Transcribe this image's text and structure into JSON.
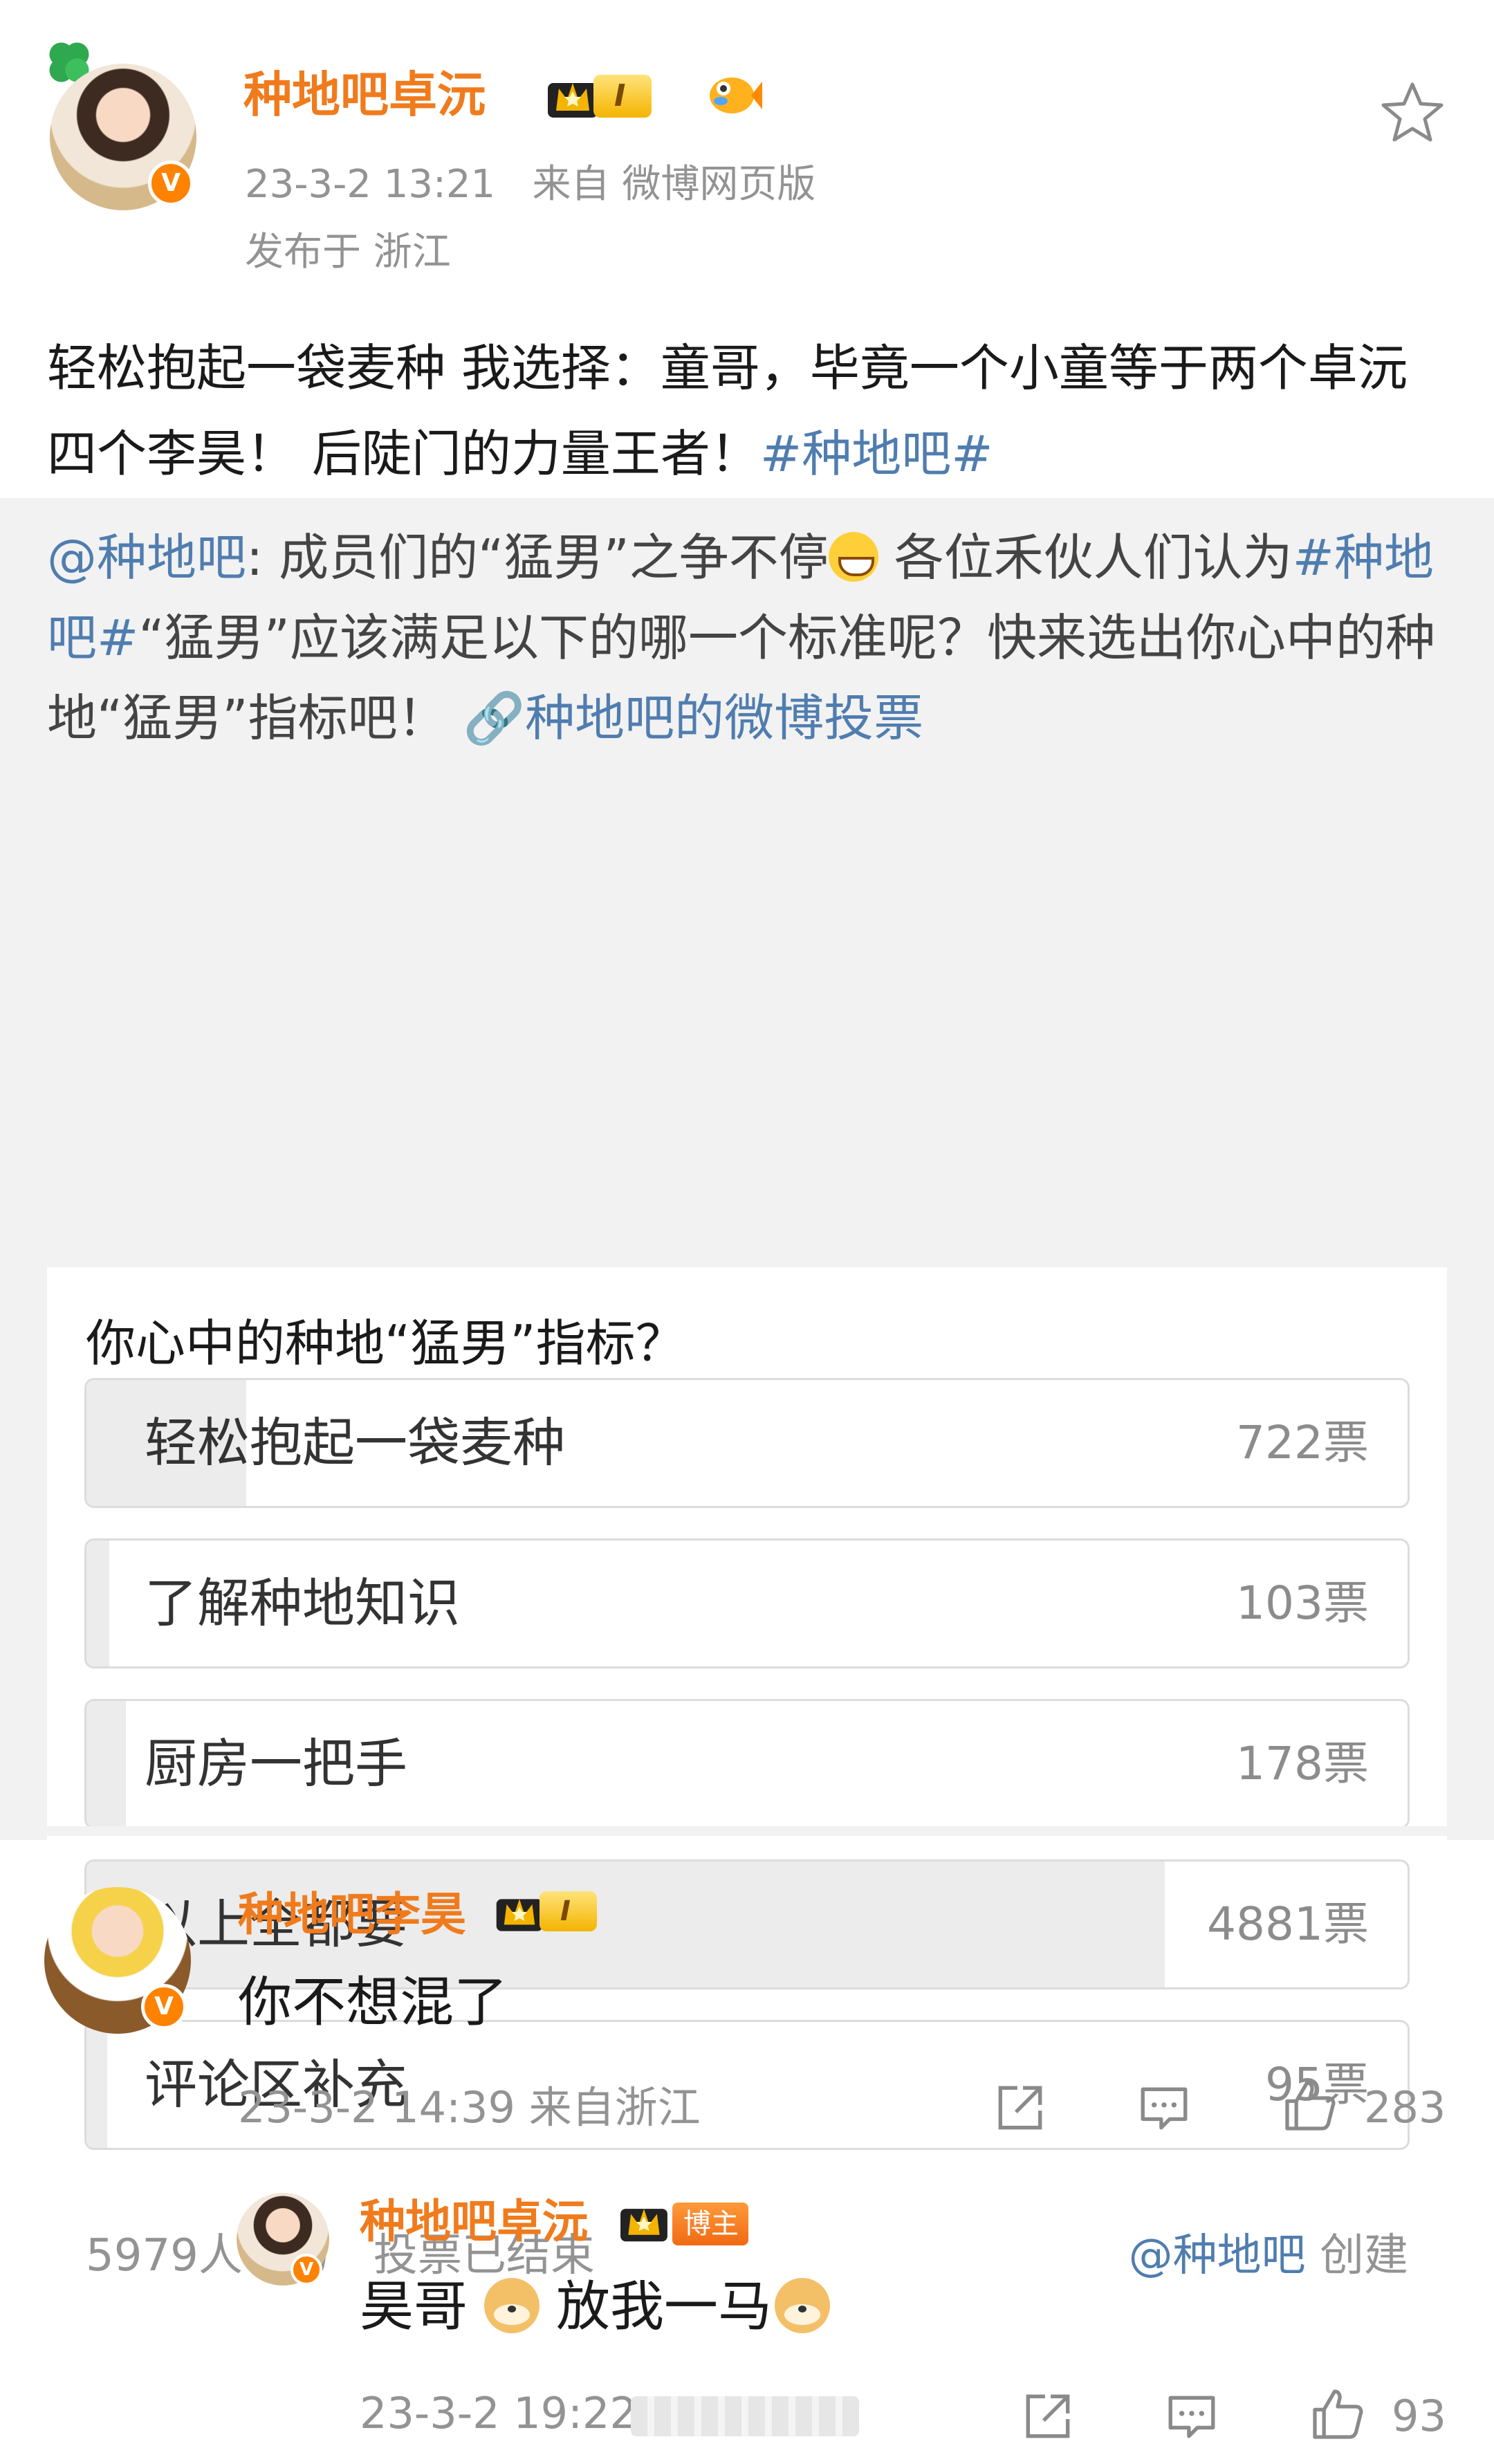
{
  "post": {
    "author": "种地吧卓沅",
    "verified_label": "V",
    "level": "I",
    "time": "23-3-2 13:21",
    "source": "来自 微博网页版",
    "location": "发布于 浙江",
    "text_main": "轻松抱起一袋麦种 我选择：童哥，毕竟一个小童等于两个卓沅四个李昊！ 后陡门的力量王者！",
    "hashtag": "#种地吧#"
  },
  "repost": {
    "mention": "@种地吧",
    "text_a": ": 成员们的“猛男”之争不停",
    "text_b": " 各位禾伙人们认为",
    "hashtag": "#种地吧#",
    "text_c": "“猛男”应该满足以下的哪一个标准呢？快来选出你心中的种地“猛男”指标吧！ ",
    "vote_link": "🔗种地吧的微博投票"
  },
  "poll": {
    "title": "你心中的种地“猛男”指标？",
    "options": [
      {
        "label": "轻松抱起一袋麦种",
        "count": "722票",
        "votes": 722
      },
      {
        "label": "了解种地知识",
        "count": "103票",
        "votes": 103
      },
      {
        "label": "厨房一把手",
        "count": "178票",
        "votes": 178
      },
      {
        "label": "以上全都要",
        "count": "4881票",
        "votes": 4881
      },
      {
        "label": "评论区补充",
        "count": "95票",
        "votes": 95
      }
    ],
    "total_votes": 5979,
    "participants": "5979人参与",
    "status": "投票已结束",
    "creator": "@种地吧",
    "creator_suffix": " 创建"
  },
  "comment": {
    "author": "种地吧李昊",
    "verified_label": "V",
    "level": "I",
    "text": "你不想混了",
    "meta": "23-3-2 14:39 来自浙江",
    "likes": "283"
  },
  "reply": {
    "author": "种地吧卓沅",
    "verified_label": "V",
    "owner_tag": "博主",
    "text_a": "昊哥",
    "text_b": "放我一马",
    "meta": "23-3-2 19:22",
    "likes": "93"
  },
  "colors": {
    "username": "#f07b1d",
    "link": "#507daf",
    "meta": "#939393",
    "repost_bg": "#f2f2f2",
    "vote_fill": "#ececec"
  },
  "icons": [
    "clover-icon",
    "crown-icon",
    "fish-icon",
    "star-icon",
    "share-icon",
    "comment-icon",
    "like-icon",
    "grin-emoji",
    "doge-emoji"
  ]
}
